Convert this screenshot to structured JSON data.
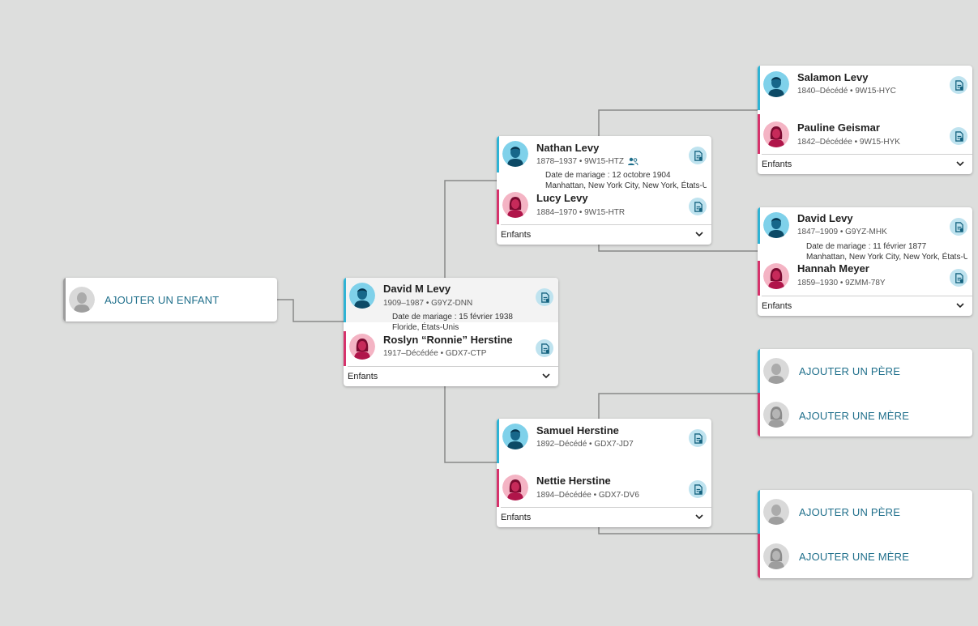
{
  "add_child": {
    "label": "AJOUTER UN ENFANT"
  },
  "root": {
    "husband": {
      "name": "David M Levy",
      "meta": "1909–1987 • G9YZ-DNN"
    },
    "marriage": {
      "date": "Date de mariage : 15 février 1938",
      "place": "Floride, États-Unis"
    },
    "wife": {
      "name": "Roslyn “Ronnie” Herstine",
      "meta": "1917–Décédée • GDX7-CTP"
    },
    "children_label": "Enfants"
  },
  "father_couple": {
    "husband": {
      "name": "Nathan Levy",
      "meta": "1878–1937 • 9W15-HTZ"
    },
    "marriage": {
      "date": "Date de mariage : 12 octobre 1904",
      "place": "Manhattan, New York City, New York, États-Unis"
    },
    "wife": {
      "name": "Lucy Levy",
      "meta": "1884–1970 • 9W15-HTR"
    },
    "children_label": "Enfants"
  },
  "mother_couple": {
    "husband": {
      "name": "Samuel Herstine",
      "meta": "1892–Décédé • GDX7-JD7"
    },
    "wife": {
      "name": "Nettie Herstine",
      "meta": "1894–Décédée • GDX7-DV6"
    },
    "children_label": "Enfants"
  },
  "gp_nathan": {
    "husband": {
      "name": "Salamon Levy",
      "meta": "1840–Décédé • 9W15-HYC"
    },
    "wife": {
      "name": "Pauline Geismar",
      "meta": "1842–Décédée • 9W15-HYK"
    },
    "children_label": "Enfants"
  },
  "gp_lucy": {
    "husband": {
      "name": "David Levy",
      "meta": "1847–1909 • G9YZ-MHK"
    },
    "marriage": {
      "date": "Date de mariage : 11 février 1877",
      "place": "Manhattan, New York City, New York, États-Unis"
    },
    "wife": {
      "name": "Hannah Meyer",
      "meta": "1859–1930 • 9ZMM-78Y"
    },
    "children_label": "Enfants"
  },
  "gp_samuel": {
    "add_father": "AJOUTER UN PÈRE",
    "add_mother": "AJOUTER UNE MÈRE"
  },
  "gp_nettie": {
    "add_father": "AJOUTER UN PÈRE",
    "add_mother": "AJOUTER UNE MÈRE"
  },
  "colors": {
    "male": "#2fb3d4",
    "female": "#d6336c",
    "link": "#1f6f8b",
    "background": "#dddedd"
  }
}
